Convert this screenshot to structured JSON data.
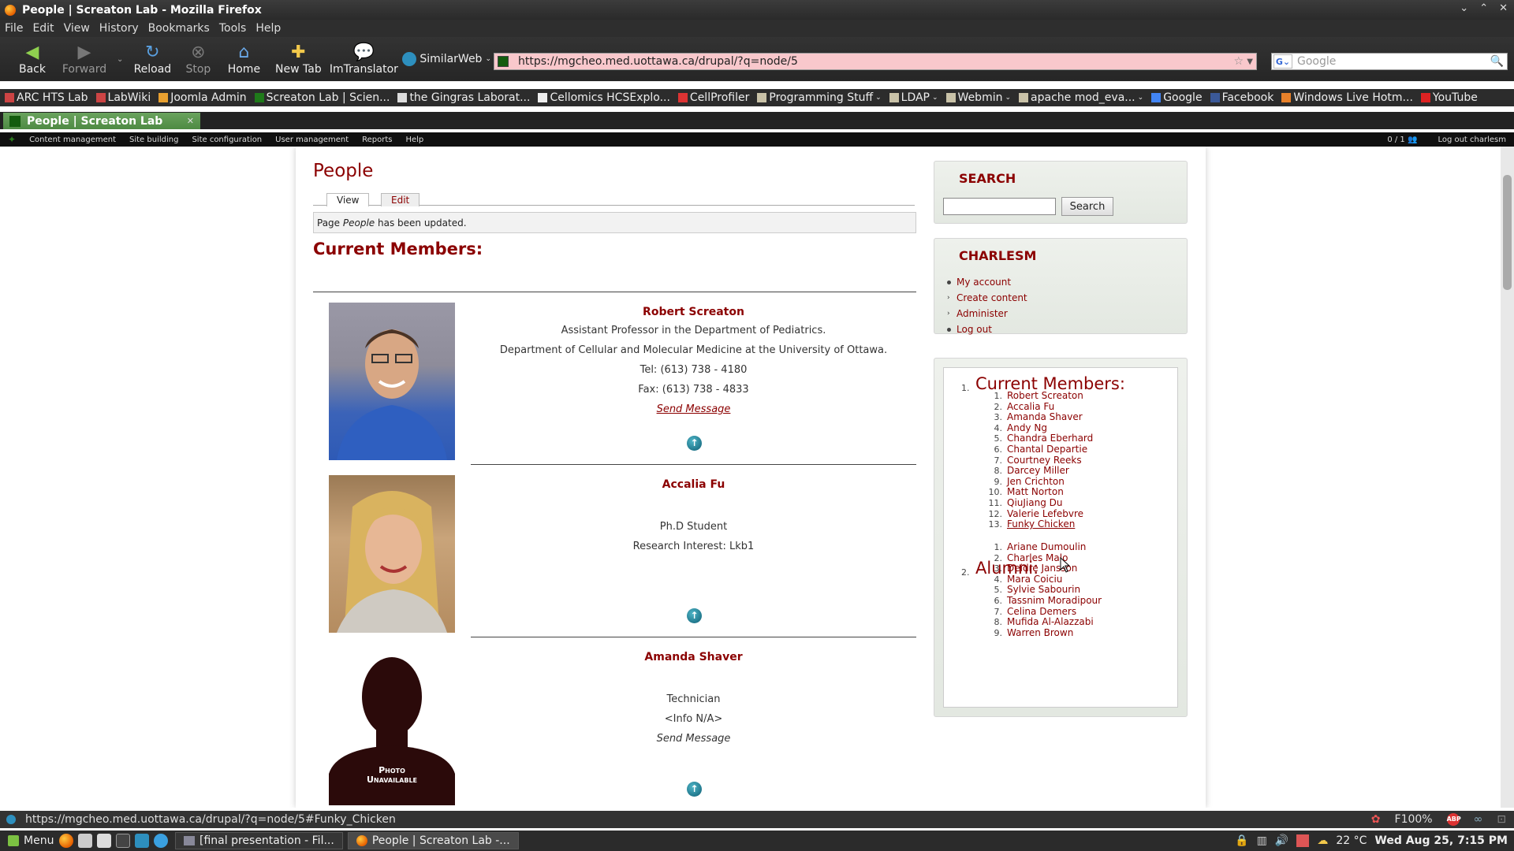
{
  "window": {
    "title": "People | Screaton Lab - Mozilla Firefox"
  },
  "menubar": [
    "File",
    "Edit",
    "View",
    "History",
    "Bookmarks",
    "Tools",
    "Help"
  ],
  "toolbar": {
    "back": "Back",
    "forward": "Forward",
    "reload": "Reload",
    "stop": "Stop",
    "home": "Home",
    "new_tab": "New Tab",
    "imtranslator": "ImTranslator",
    "similarweb": "SimilarWeb",
    "url": "https://mgcheo.med.uottawa.ca/drupal/?q=node/5",
    "search_placeholder": "Google"
  },
  "bookmarks": [
    "ARC HTS Lab",
    "LabWiki",
    "Joomla Admin",
    "Screaton Lab | Scien...",
    "the Gingras Laborat...",
    "Cellomics HCSExplo...",
    "CellProfiler",
    "Programming Stuff",
    "LDAP",
    "Webmin",
    "apache mod_eva...",
    "Google",
    "Facebook",
    "Windows Live Hotm...",
    "YouTube"
  ],
  "tab": {
    "title": "People | Screaton Lab"
  },
  "admin_menu": {
    "items": [
      "Content management",
      "Site building",
      "Site configuration",
      "User management",
      "Reports",
      "Help"
    ],
    "counter": "0 / 1",
    "logout": "Log out charlesm"
  },
  "page": {
    "title": "People",
    "tab_view": "View",
    "tab_edit": "Edit",
    "status_prefix": "Page ",
    "status_em": "People",
    "status_suffix": " has been updated.",
    "current_members_heading": "Current Members:"
  },
  "people": [
    {
      "name": "Robert Screaton",
      "lines": [
        "Assistant Professor in the Department of Pediatrics.",
        "Department of Cellular and Molecular Medicine at the University of Ottawa.",
        "Tel:  (613) 738 - 4180",
        "Fax: (613) 738 - 4833"
      ],
      "message": "Send Message"
    },
    {
      "name": "Accalia Fu",
      "lines": [
        "Ph.D Student",
        "Research Interest: Lkb1"
      ]
    },
    {
      "name": "Amanda Shaver",
      "lines": [
        "Technician",
        "<Info N/A>"
      ],
      "message": "Send Message",
      "photo_caption_1": "Photo",
      "photo_caption_2": "Unavailable"
    }
  ],
  "sidebar": {
    "search_title": "SEARCH",
    "search_button": "Search",
    "user_title": "CHARLESM",
    "user_links": [
      "My account",
      "Create content",
      "Administer",
      "Log out"
    ],
    "toc": {
      "current_heading": "Current Members:",
      "current": [
        "Robert Screaton",
        "Accalia Fu",
        "Amanda Shaver",
        "Andy Ng",
        "Chandra Eberhard",
        "Chantal Departie",
        "Courtney Reeks",
        "Darcey Miller",
        "Jen Crichton",
        "Matt Norton",
        "QiuJiang Du",
        "Valerie Lefebvre",
        "Funky Chicken"
      ],
      "alumni_heading": "Alumni:",
      "alumni": [
        "Ariane Dumoulin",
        "Charles Malo",
        "Deidre Jansson",
        "Mara Coiciu",
        "Sylvie Sabourin",
        "Tassnim Moradipour",
        "Celina Demers",
        "Mufida Al-Alazzabi",
        "Warren Brown"
      ]
    }
  },
  "statusbar": {
    "url": "https://mgcheo.med.uottawa.ca/drupal/?q=node/5#Funky_Chicken",
    "zoom": "F100%"
  },
  "taskbar": {
    "menu": "Menu",
    "task1": "[final presentation - Fil...",
    "task2": "People | Screaton Lab -...",
    "weather": "22 °C",
    "clock": "Wed Aug 25,  7:15 PM"
  },
  "colors": {
    "accent": "#8b0000",
    "urlbar_bg": "#f9c8cc",
    "tab_green": "#5a9a4e"
  }
}
